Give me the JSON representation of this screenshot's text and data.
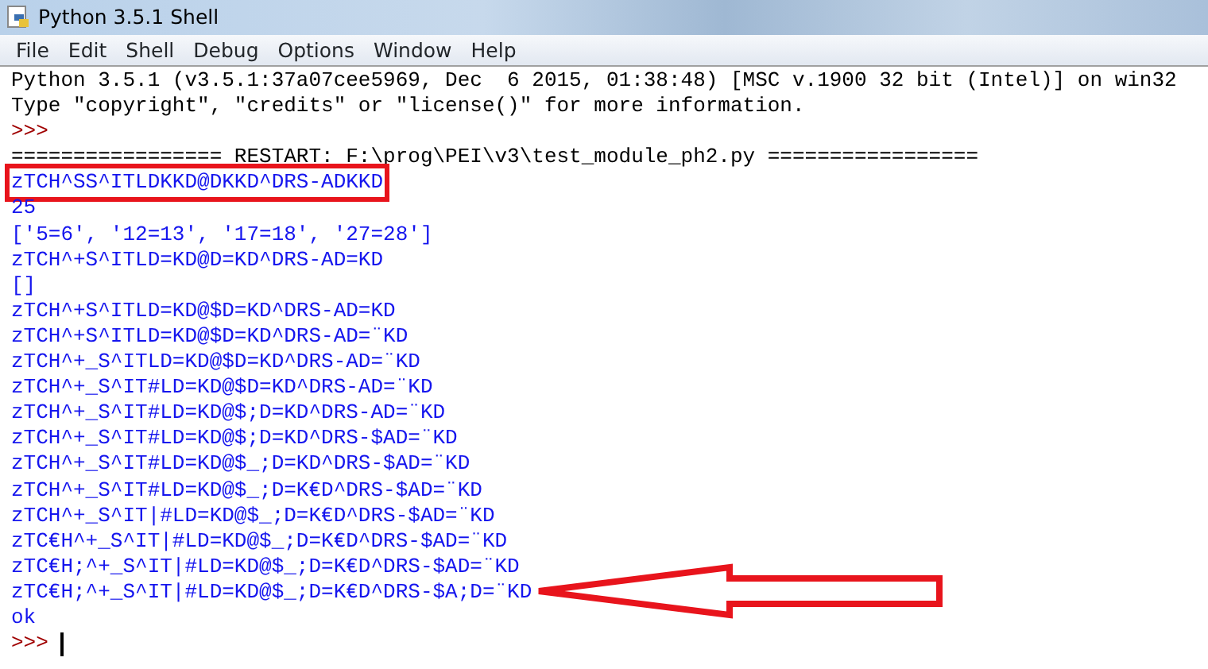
{
  "window": {
    "title": "Python 3.5.1 Shell"
  },
  "menu": [
    "File",
    "Edit",
    "Shell",
    "Debug",
    "Options",
    "Window",
    "Help"
  ],
  "lines": [
    {
      "kind": "info",
      "text": "Python 3.5.1 (v3.5.1:37a07cee5969, Dec  6 2015, 01:38:48) [MSC v.1900 32 bit (Intel)] on win32",
      "boxed": false,
      "arrowed": false
    },
    {
      "kind": "info",
      "text": "Type \"copyright\", \"credits\" or \"license()\" for more information.",
      "boxed": false,
      "arrowed": false
    },
    {
      "kind": "prompt",
      "text": ">>>",
      "boxed": false,
      "arrowed": false
    },
    {
      "kind": "restart",
      "text": "================= RESTART: F:\\prog\\PEI\\v3\\test_module_ph2.py =================",
      "boxed": false,
      "arrowed": false
    },
    {
      "kind": "output",
      "text": "zTCH^SS^ITLDKKD@DKKD^DRS-ADKKD",
      "boxed": true,
      "arrowed": false
    },
    {
      "kind": "output",
      "text": "25",
      "boxed": false,
      "arrowed": false
    },
    {
      "kind": "output",
      "text": "['5=6', '12=13', '17=18', '27=28']",
      "boxed": false,
      "arrowed": false
    },
    {
      "kind": "output",
      "text": "zTCH^+S^ITLD=KD@D=KD^DRS-AD=KD",
      "boxed": false,
      "arrowed": false
    },
    {
      "kind": "output",
      "text": "[]",
      "boxed": false,
      "arrowed": false
    },
    {
      "kind": "output",
      "text": "zTCH^+S^ITLD=KD@$D=KD^DRS-AD=KD",
      "boxed": false,
      "arrowed": false
    },
    {
      "kind": "output",
      "text": "zTCH^+S^ITLD=KD@$D=KD^DRS-AD=¨KD",
      "boxed": false,
      "arrowed": false
    },
    {
      "kind": "output",
      "text": "zTCH^+_S^ITLD=KD@$D=KD^DRS-AD=¨KD",
      "boxed": false,
      "arrowed": false
    },
    {
      "kind": "output",
      "text": "zTCH^+_S^IT#LD=KD@$D=KD^DRS-AD=¨KD",
      "boxed": false,
      "arrowed": false
    },
    {
      "kind": "output",
      "text": "zTCH^+_S^IT#LD=KD@$;D=KD^DRS-AD=¨KD",
      "boxed": false,
      "arrowed": false
    },
    {
      "kind": "output",
      "text": "zTCH^+_S^IT#LD=KD@$;D=KD^DRS-$AD=¨KD",
      "boxed": false,
      "arrowed": false
    },
    {
      "kind": "output",
      "text": "zTCH^+_S^IT#LD=KD@$_;D=KD^DRS-$AD=¨KD",
      "boxed": false,
      "arrowed": false
    },
    {
      "kind": "output",
      "text": "zTCH^+_S^IT#LD=KD@$_;D=K€D^DRS-$AD=¨KD",
      "boxed": false,
      "arrowed": false
    },
    {
      "kind": "output",
      "text": "zTCH^+_S^IT|#LD=KD@$_;D=K€D^DRS-$AD=¨KD",
      "boxed": false,
      "arrowed": false
    },
    {
      "kind": "output",
      "text": "zTC€H^+_S^IT|#LD=KD@$_;D=K€D^DRS-$AD=¨KD",
      "boxed": false,
      "arrowed": false
    },
    {
      "kind": "output",
      "text": "zTC€H;^+_S^IT|#LD=KD@$_;D=K€D^DRS-$AD=¨KD",
      "boxed": false,
      "arrowed": false
    },
    {
      "kind": "output",
      "text": "zTC€H;^+_S^IT|#LD=KD@$_;D=K€D^DRS-$A;D=¨KD",
      "boxed": false,
      "arrowed": true
    },
    {
      "kind": "output",
      "text": "ok",
      "boxed": false,
      "arrowed": false
    },
    {
      "kind": "prompt",
      "text": ">>>",
      "boxed": false,
      "arrowed": false,
      "cursor": true
    }
  ]
}
